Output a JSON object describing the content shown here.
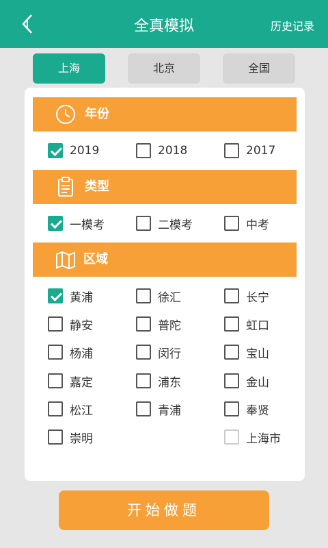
{
  "header": {
    "title": "全真模拟",
    "history_label": "历史记录"
  },
  "city_tabs": [
    {
      "label": "上海",
      "active": true
    },
    {
      "label": "北京",
      "active": false
    },
    {
      "label": "全国",
      "active": false
    }
  ],
  "sections": {
    "year": {
      "title": "年份",
      "icon": "clock-icon",
      "options": [
        {
          "label": "2019",
          "checked": true
        },
        {
          "label": "2018",
          "checked": false
        },
        {
          "label": "2017",
          "checked": false
        }
      ]
    },
    "type": {
      "title": "类型",
      "icon": "clipboard-icon",
      "options": [
        {
          "label": "一模考",
          "checked": true
        },
        {
          "label": "二模考",
          "checked": false
        },
        {
          "label": "中考",
          "checked": false
        }
      ]
    },
    "region": {
      "title": "区域",
      "icon": "map-icon",
      "options": [
        {
          "label": "黄浦",
          "checked": true
        },
        {
          "label": "徐汇",
          "checked": false
        },
        {
          "label": "长宁",
          "checked": false
        },
        {
          "label": "静安",
          "checked": false
        },
        {
          "label": "普陀",
          "checked": false
        },
        {
          "label": "虹口",
          "checked": false
        },
        {
          "label": "杨浦",
          "checked": false
        },
        {
          "label": "闵行",
          "checked": false
        },
        {
          "label": "宝山",
          "checked": false
        },
        {
          "label": "嘉定",
          "checked": false
        },
        {
          "label": "浦东",
          "checked": false
        },
        {
          "label": "金山",
          "checked": false
        },
        {
          "label": "松江",
          "checked": false
        },
        {
          "label": "青浦",
          "checked": false
        },
        {
          "label": "奉贤",
          "checked": false
        },
        {
          "label": "崇明",
          "checked": false
        },
        {
          "label": "上海市",
          "checked": false,
          "disabled": true
        }
      ]
    }
  },
  "start_button": {
    "label": "开始做题"
  },
  "colors": {
    "primary": "#1aaa8f",
    "accent": "#f7a038",
    "background": "#e6e6e6"
  }
}
